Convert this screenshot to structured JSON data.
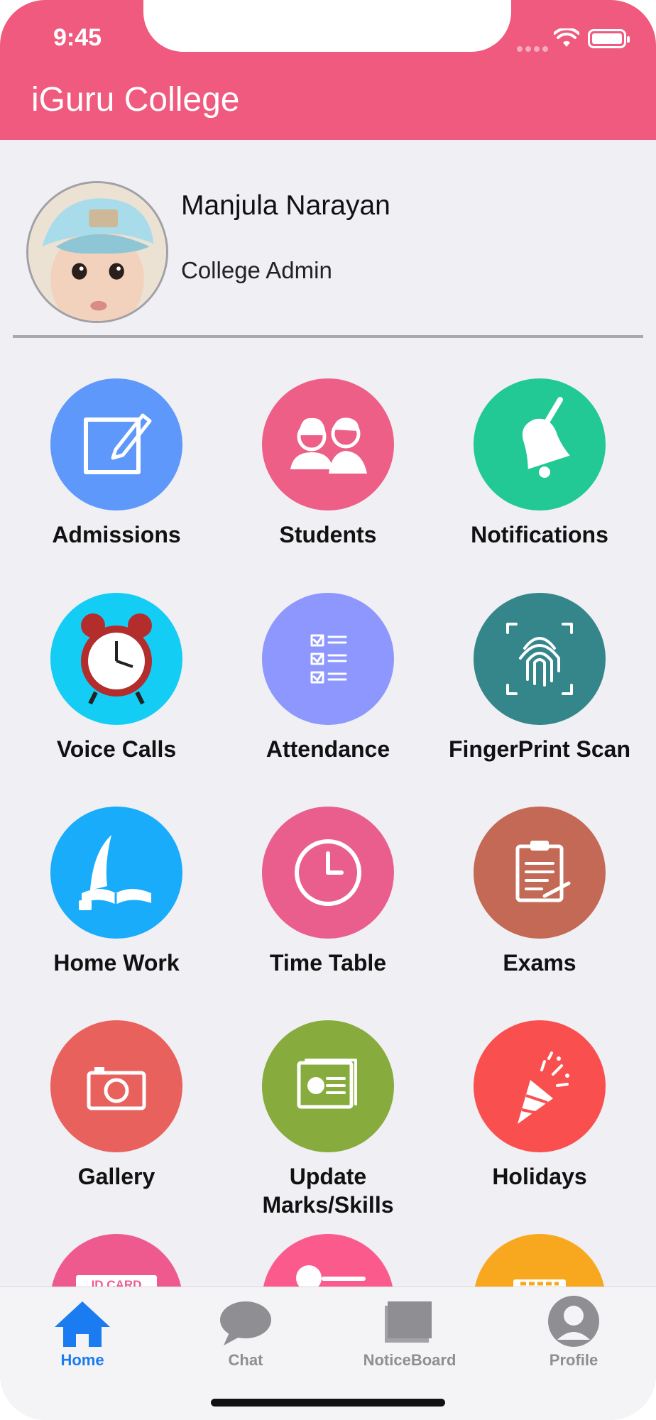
{
  "status": {
    "time": "9:45"
  },
  "header": {
    "title": "iGuru College"
  },
  "profile": {
    "name": "Manjula Narayan",
    "role": "College Admin"
  },
  "tiles": [
    {
      "label": "Admissions",
      "color": "#5e98fb",
      "icon": "edit-icon"
    },
    {
      "label": "Students",
      "color": "#ee5f87",
      "icon": "students-icon"
    },
    {
      "label": "Notifications",
      "color": "#22c994",
      "icon": "bell-icon"
    },
    {
      "label": "Voice Calls",
      "color": "#13cdf5",
      "icon": "alarm-clock-icon"
    },
    {
      "label": "Attendance",
      "color": "#8d97fd",
      "icon": "checklist-icon"
    },
    {
      "label": "FingerPrint Scan",
      "color": "#35868b",
      "icon": "fingerprint-icon"
    },
    {
      "label": "Home Work",
      "color": "#18acfb",
      "icon": "quill-book-icon"
    },
    {
      "label": "Time Table",
      "color": "#e95e8c",
      "icon": "clock-icon"
    },
    {
      "label": "Exams",
      "color": "#c36955",
      "icon": "clipboard-icon"
    },
    {
      "label": "Gallery",
      "color": "#e9615d",
      "icon": "camera-icon"
    },
    {
      "label": "Update Marks/Skills",
      "color": "#87ab3d",
      "icon": "report-icon"
    },
    {
      "label": "Holidays",
      "color": "#fa4f4f",
      "icon": "party-popper-icon"
    },
    {
      "label": "",
      "color": "#ef5a8e",
      "icon": "id-card-icon",
      "badge": "ID CARD"
    },
    {
      "label": "",
      "color": "#fb5a8c",
      "icon": "toggle-icon"
    },
    {
      "label": "",
      "color": "#f8a81e",
      "icon": "calendar-icon"
    }
  ],
  "tabbar": [
    {
      "label": "Home",
      "icon": "home-icon",
      "active": true
    },
    {
      "label": "Chat",
      "icon": "chat-icon",
      "active": false
    },
    {
      "label": "NoticeBoard",
      "icon": "noticeboard-icon",
      "active": false
    },
    {
      "label": "Profile",
      "icon": "profile-icon",
      "active": false
    }
  ]
}
